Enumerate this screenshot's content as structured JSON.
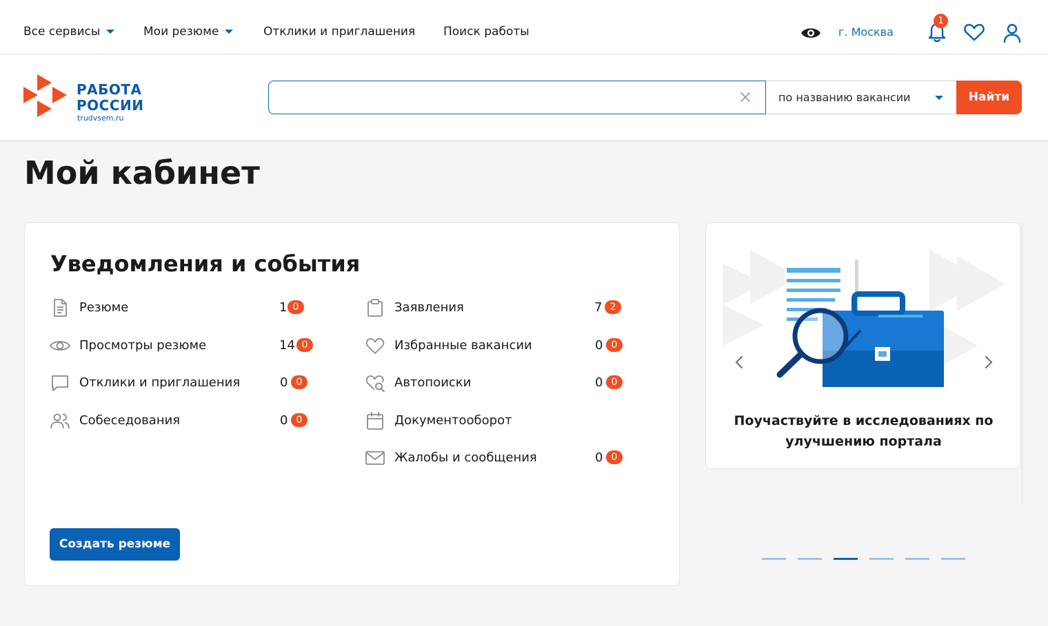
{
  "topnav": {
    "items": [
      {
        "label": "Все сервисы",
        "dropdown": true
      },
      {
        "label": "Мои резюме",
        "dropdown": true
      },
      {
        "label": "Отклики и приглашения",
        "dropdown": false
      },
      {
        "label": "Поиск работы",
        "dropdown": false
      }
    ],
    "city": "г. Москва",
    "notifications_count": "1"
  },
  "logo": {
    "line1": "РАБОТА",
    "line2": "РОССИИ",
    "domain": "trudvsem.ru"
  },
  "search": {
    "value": "",
    "placeholder": "",
    "type_label": "по названию вакансии",
    "button_label": "Найти"
  },
  "page_title": "Мой кабинет",
  "notifications": {
    "title": "Уведомления и события",
    "left": [
      {
        "label": "Резюме",
        "count": "1",
        "badge": "0",
        "icon": "document-icon"
      },
      {
        "label": "Просмотры резюме",
        "count": "14",
        "badge": "0",
        "icon": "eye-icon"
      },
      {
        "label": "Отклики и приглашения",
        "count": "0",
        "badge": "0",
        "icon": "chat-icon"
      },
      {
        "label": "Собеседования",
        "count": "0",
        "badge": "0",
        "icon": "users-icon"
      }
    ],
    "right": [
      {
        "label": "Заявления",
        "count": "7",
        "badge": "2",
        "icon": "clipboard-icon"
      },
      {
        "label": "Избранные вакансии",
        "count": "0",
        "badge": "0",
        "icon": "heart-icon"
      },
      {
        "label": "Автопоиски",
        "count": "0",
        "badge": "0",
        "icon": "autosearch-icon"
      },
      {
        "label": "Документооборот",
        "count": "",
        "badge": "",
        "icon": "calendar-icon"
      },
      {
        "label": "Жалобы и сообщения",
        "count": "0",
        "badge": "0",
        "icon": "mail-icon"
      }
    ],
    "create_button": "Создать резюме"
  },
  "promo": {
    "caption_line1": "Поучаствуйте в исследованиях по",
    "caption_line2": "улучшению портала",
    "slides_total": 6,
    "active_slide": 3
  },
  "colors": {
    "brand_blue": "#0a62b5",
    "accent_orange": "#f04e23"
  }
}
